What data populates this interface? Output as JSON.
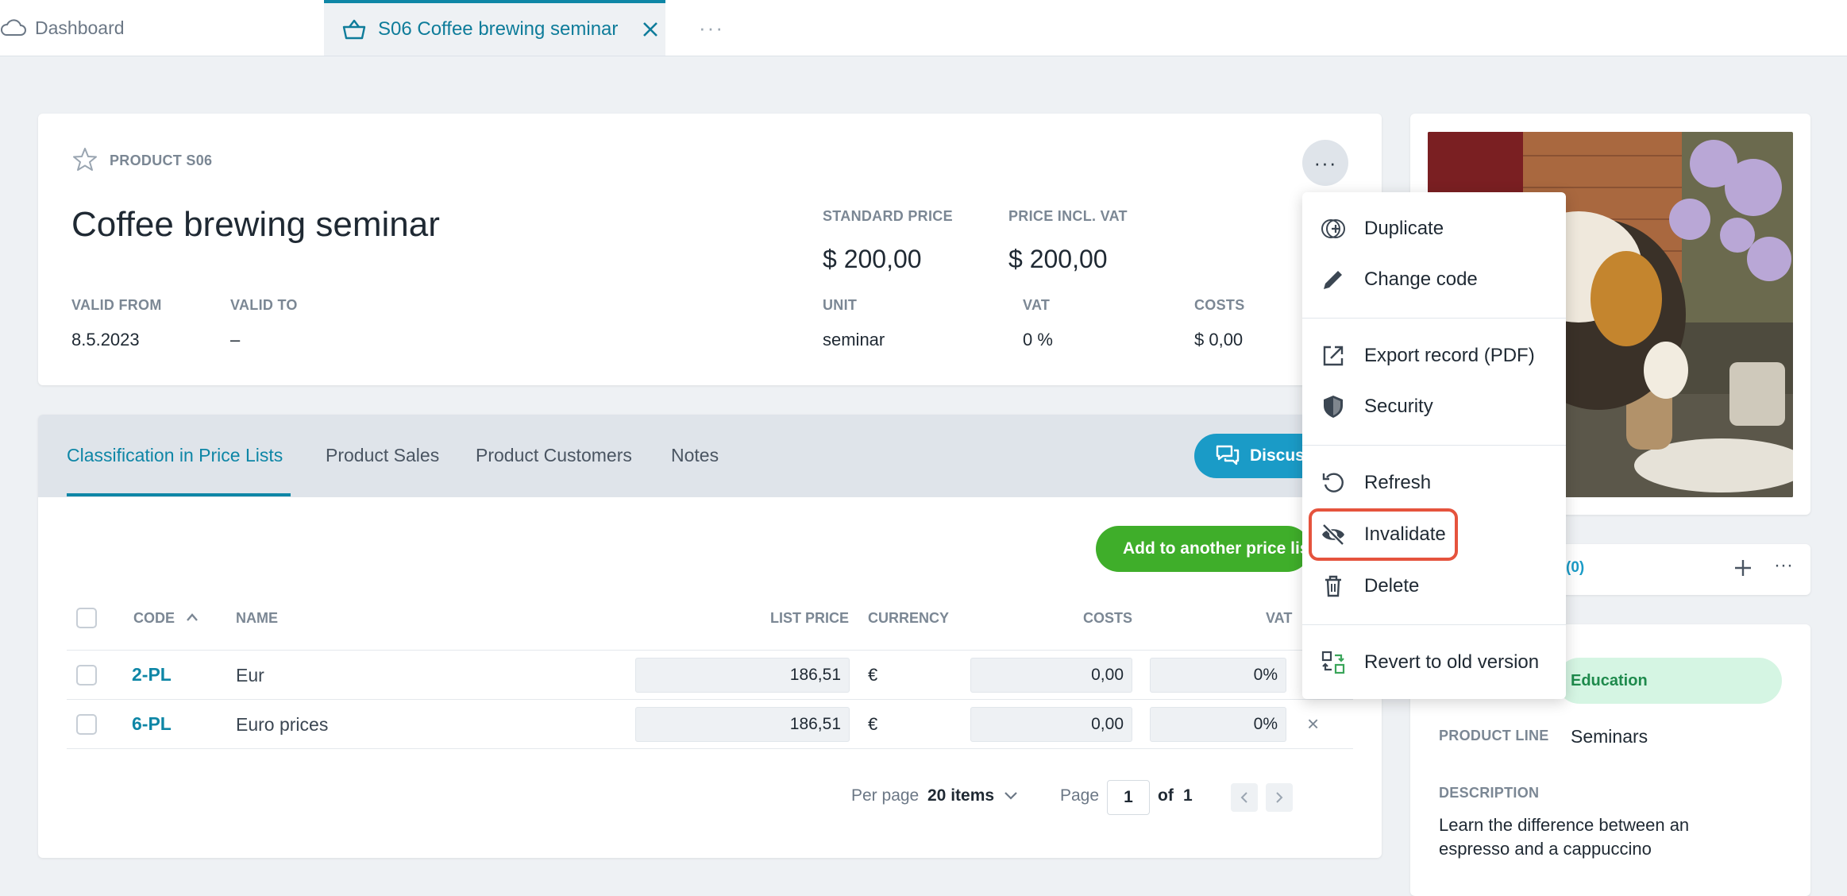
{
  "tabbar": {
    "dashboard_label": "Dashboard",
    "active_tab_label": "S06 Coffee brewing seminar",
    "more_label": "···"
  },
  "product": {
    "code_label": "PRODUCT S06",
    "title": "Coffee brewing seminar",
    "valid_from_label": "VALID FROM",
    "valid_from": "8.5.2023",
    "valid_to_label": "VALID TO",
    "valid_to": "–",
    "standard_price_label": "STANDARD PRICE",
    "standard_price": "$ 200,00",
    "price_incl_vat_label": "PRICE INCL. VAT",
    "price_incl_vat": "$ 200,00",
    "unit_label": "UNIT",
    "unit": "seminar",
    "vat_label": "VAT",
    "vat": "0 %",
    "costs_label": "COSTS",
    "costs": "$ 0,00",
    "more_label": "···"
  },
  "tabs": [
    {
      "label": "Classification in Price Lists",
      "active": true
    },
    {
      "label": "Product Sales",
      "active": false
    },
    {
      "label": "Product Customers",
      "active": false
    },
    {
      "label": "Notes",
      "active": false
    }
  ],
  "discuss_label": "Discuss",
  "add_label": "Add to another price list",
  "table": {
    "headers": {
      "code": "CODE",
      "name": "NAME",
      "list_price": "LIST PRICE",
      "currency": "CURRENCY",
      "costs": "COSTS",
      "vat": "VAT"
    },
    "rows": [
      {
        "code": "2-PL",
        "name": "Eur",
        "list_price": "186,51",
        "currency": "€",
        "costs": "0,00",
        "vat": "0%"
      },
      {
        "code": "6-PL",
        "name": "Euro prices",
        "list_price": "186,51",
        "currency": "€",
        "costs": "0,00",
        "vat": "0%"
      }
    ],
    "remove_label": "×"
  },
  "pager": {
    "per_page_label": "Per page",
    "per_page_value": "20 items",
    "page_label": "Page",
    "page_value": "1",
    "of_label": "of",
    "total_pages": "1"
  },
  "attachments": {
    "count_label": "(0)"
  },
  "info": {
    "category_badge": "Education",
    "product_line_label": "PRODUCT LINE",
    "product_line": "Seminars",
    "description_label": "DESCRIPTION",
    "description_line1": "Learn the difference between an",
    "description_line2": "espresso and a cappuccino"
  },
  "menu": {
    "items": [
      {
        "label": "Duplicate",
        "icon": "duplicate-icon"
      },
      {
        "label": "Change code",
        "icon": "pencil-icon"
      },
      {
        "label": "Export record (PDF)",
        "icon": "export-icon"
      },
      {
        "label": "Security",
        "icon": "shield-icon"
      },
      {
        "label": "Refresh",
        "icon": "refresh-icon"
      },
      {
        "label": "Invalidate",
        "icon": "eye-off-icon"
      },
      {
        "label": "Delete",
        "icon": "trash-icon"
      },
      {
        "label": "Revert to old version",
        "icon": "revert-icon"
      }
    ]
  },
  "colors": {
    "accent": "#0e86a6",
    "add_button": "#3fae2a",
    "highlight": "#e5533d",
    "badge_bg": "#d5f5e3"
  }
}
